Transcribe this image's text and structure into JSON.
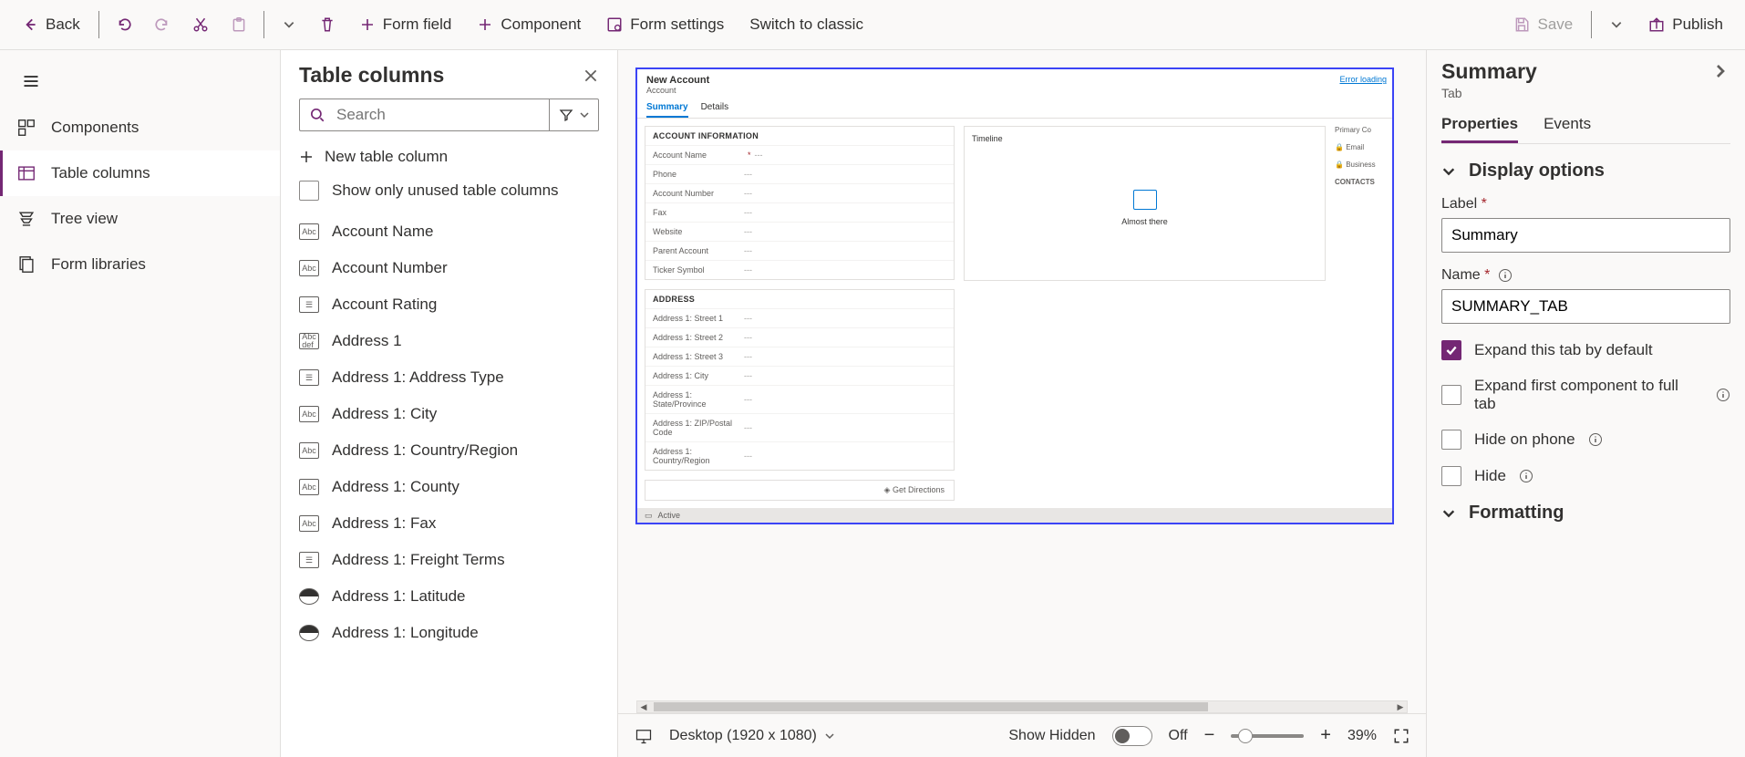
{
  "commandBar": {
    "back": "Back",
    "formField": "Form field",
    "component": "Component",
    "formSettings": "Form settings",
    "switchClassic": "Switch to classic",
    "save": "Save",
    "publish": "Publish"
  },
  "leftNav": {
    "components": "Components",
    "tableColumns": "Table columns",
    "treeView": "Tree view",
    "formLibraries": "Form libraries"
  },
  "columnsPanel": {
    "title": "Table columns",
    "searchPlaceholder": "Search",
    "newColumn": "New table column",
    "showUnused": "Show only unused table columns",
    "columns": [
      {
        "label": "Account Name",
        "type": "Abc"
      },
      {
        "label": "Account Number",
        "type": "Abc"
      },
      {
        "label": "Account Rating",
        "type": "Opt"
      },
      {
        "label": "Address 1",
        "type": "Abcdef"
      },
      {
        "label": "Address 1: Address Type",
        "type": "Opt"
      },
      {
        "label": "Address 1: City",
        "type": "Abc"
      },
      {
        "label": "Address 1: Country/Region",
        "type": "Abc"
      },
      {
        "label": "Address 1: County",
        "type": "Abc"
      },
      {
        "label": "Address 1: Fax",
        "type": "Abc"
      },
      {
        "label": "Address 1: Freight Terms",
        "type": "Opt"
      },
      {
        "label": "Address 1: Latitude",
        "type": "Glb"
      },
      {
        "label": "Address 1: Longitude",
        "type": "Glb"
      }
    ]
  },
  "formPreview": {
    "title": "New Account",
    "subtitle": "Account",
    "tabs": [
      "Summary",
      "Details"
    ],
    "errorLoading": "Error loading",
    "sectionA": {
      "title": "ACCOUNT INFORMATION",
      "rows": [
        {
          "label": "Account Name",
          "required": true
        },
        {
          "label": "Phone"
        },
        {
          "label": "Account Number"
        },
        {
          "label": "Fax"
        },
        {
          "label": "Website"
        },
        {
          "label": "Parent Account"
        },
        {
          "label": "Ticker Symbol"
        }
      ]
    },
    "sectionB": {
      "title": "ADDRESS",
      "rows": [
        {
          "label": "Address 1: Street 1"
        },
        {
          "label": "Address 1: Street 2"
        },
        {
          "label": "Address 1: Street 3"
        },
        {
          "label": "Address 1: City"
        },
        {
          "label": "Address 1: State/Province"
        },
        {
          "label": "Address 1: ZIP/Postal Code"
        },
        {
          "label": "Address 1: Country/Region"
        }
      ]
    },
    "getDirections": "Get Directions",
    "timeline": {
      "title": "Timeline",
      "status": "Almost there"
    },
    "rightPanel": {
      "primaryContact": "Primary Co",
      "email": "Email",
      "business": "Business",
      "contacts": "CONTACTS"
    },
    "statusActive": "Active"
  },
  "footer": {
    "device": "Desktop (1920 x 1080)",
    "showHidden": "Show Hidden",
    "toggleState": "Off",
    "zoom": "39%"
  },
  "propPanel": {
    "title": "Summary",
    "subtype": "Tab",
    "tabs": {
      "properties": "Properties",
      "events": "Events"
    },
    "sections": {
      "display": "Display options",
      "formatting": "Formatting"
    },
    "labelField": {
      "label": "Label",
      "value": "Summary"
    },
    "nameField": {
      "label": "Name",
      "value": "SUMMARY_TAB"
    },
    "expandDefault": "Expand this tab by default",
    "expandFirst": "Expand first component to full tab",
    "hidePhone": "Hide on phone",
    "hide": "Hide"
  }
}
